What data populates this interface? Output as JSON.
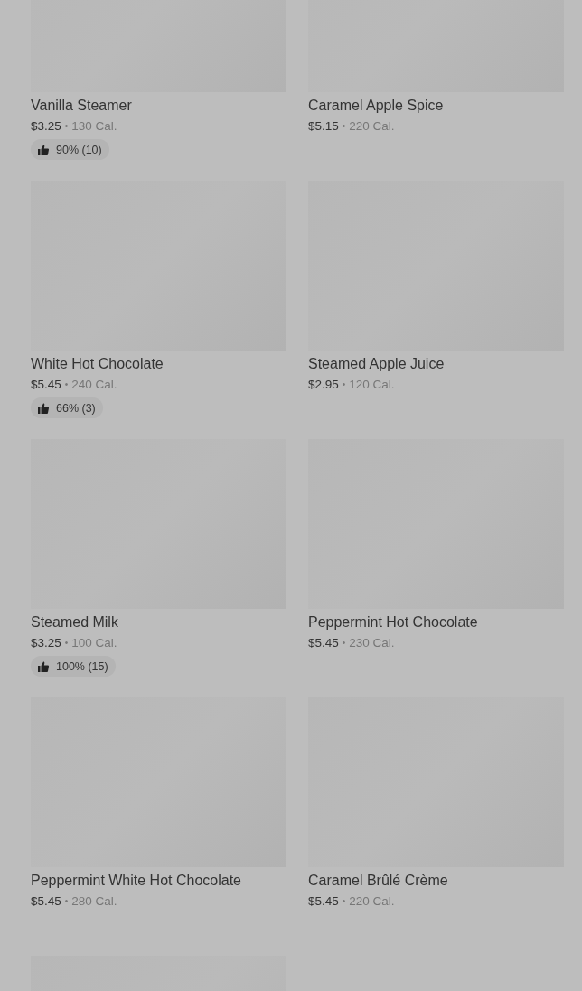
{
  "items": [
    {
      "name": "Vanilla Steamer",
      "price": "$3.25",
      "separator": "•",
      "calories": "130 Cal.",
      "rating": "90% (10)"
    },
    {
      "name": "Caramel Apple Spice",
      "price": "$5.15",
      "separator": "•",
      "calories": "220 Cal."
    },
    {
      "name": "White Hot Chocolate",
      "price": "$5.45",
      "separator": "•",
      "calories": "240 Cal.",
      "rating": "66% (3)"
    },
    {
      "name": "Steamed Apple Juice",
      "price": "$2.95",
      "separator": "•",
      "calories": "120 Cal."
    },
    {
      "name": "Steamed Milk",
      "price": "$3.25",
      "separator": "•",
      "calories": "100 Cal.",
      "rating": "100% (15)"
    },
    {
      "name": "Peppermint Hot Chocolate",
      "price": "$5.45",
      "separator": "•",
      "calories": "230 Cal."
    },
    {
      "name": "Peppermint White Hot Chocolate",
      "price": "$5.45",
      "separator": "•",
      "calories": "280 Cal."
    },
    {
      "name": "Caramel Brûlé Crème",
      "price": "$5.45",
      "separator": "•",
      "calories": "220 Cal."
    }
  ]
}
